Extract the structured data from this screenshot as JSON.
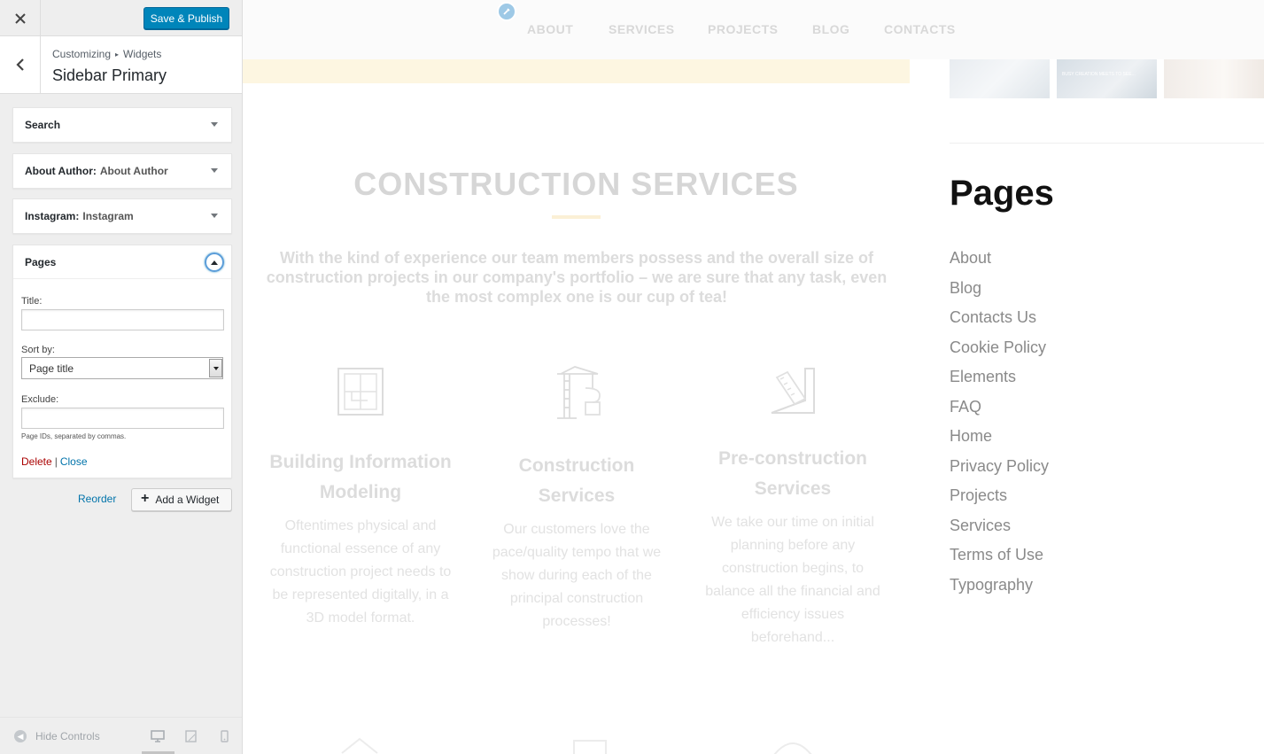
{
  "toolbar": {
    "close_icon": "close-icon",
    "publish_label": "Save & Publish"
  },
  "section": {
    "breadcrumb_root": "Customizing",
    "breadcrumb_sep": "▸",
    "breadcrumb_leaf": "Widgets",
    "title": "Sidebar Primary"
  },
  "widgets": [
    {
      "name": "Search",
      "sub": ""
    },
    {
      "name": "About Author:",
      "sub": "About Author"
    },
    {
      "name": "Instagram:",
      "sub": "Instagram"
    },
    {
      "name": "Pages",
      "sub": ""
    }
  ],
  "pages_form": {
    "title_label": "Title:",
    "title_value": "",
    "sort_label": "Sort by:",
    "sort_value": "Page title",
    "exclude_label": "Exclude:",
    "exclude_value": "",
    "hint": "Page IDs, separated by commas.",
    "delete_label": "Delete",
    "sep": "|",
    "close_label": "Close"
  },
  "panel_actions": {
    "reorder_label": "Reorder",
    "add_widget_label": "Add a Widget"
  },
  "footer": {
    "hide_controls_label": "Hide Controls"
  },
  "preview": {
    "nav": [
      "ABOUT",
      "SERVICES",
      "PROJECTS",
      "BLOG",
      "CONTACTS"
    ],
    "thumb_text": "BUSY CREATION MEETS TO SEE...",
    "services_title": "CONSTRUCTION SERVICES",
    "services_lead": "With the kind of experience our team members possess and the overall size of construction projects in our company's portfolio – we are sure that any task, even the most complex one is our cup of tea!",
    "services": [
      {
        "title": "Building Information Modeling",
        "text": "Oftentimes physical and functional essence of any construction project needs to be represented digitally, in a 3D model format."
      },
      {
        "title": "Construction Services",
        "text": "Our customers love the pace/quality tempo that we show during each of the principal construction processes!"
      },
      {
        "title": "Pre-construction Services",
        "text": "We take our time on initial planning before any construction begins, to balance all the financial and efficiency issues beforehand..."
      }
    ],
    "sidebar_title": "Pages",
    "sidebar_pages": [
      "About",
      "Blog",
      "Contacts Us",
      "Cookie Policy",
      "Elements",
      "FAQ",
      "Home",
      "Privacy Policy",
      "Projects",
      "Services",
      "Terms of Use",
      "Typography"
    ]
  },
  "colors": {
    "accent": "#0085ba",
    "link": "#0073aa",
    "danger": "#a00000"
  }
}
